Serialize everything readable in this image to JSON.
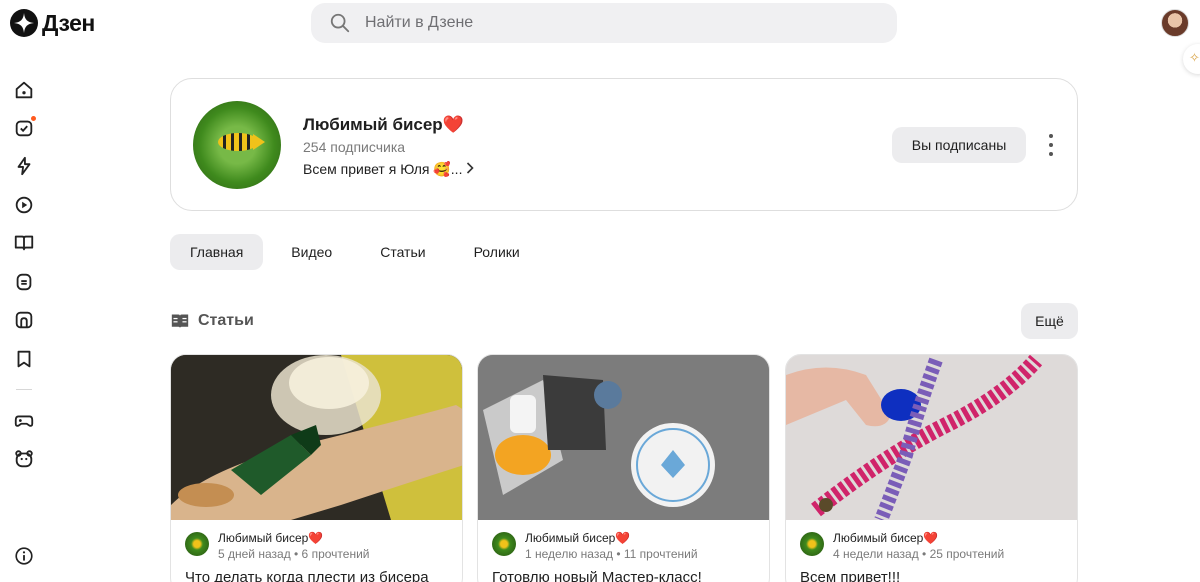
{
  "header": {
    "logo_text": "Дзен",
    "search_placeholder": "Найти в Дзене"
  },
  "nav": {
    "items": [
      "home-icon",
      "subscriptions-icon",
      "lightning-icon",
      "video-icon",
      "articles-icon",
      "chat-icon",
      "shorts-icon",
      "bookmark-icon",
      "gamepad-icon",
      "kids-icon",
      "info-icon"
    ]
  },
  "channel": {
    "name": "Любимый бисер",
    "heart": "❤️",
    "subscribers": "254 подписчика",
    "description": "Всем привет я Юля 🥰...",
    "subscribed_label": "Вы подписаны"
  },
  "tabs": [
    {
      "label": "Главная",
      "active": true
    },
    {
      "label": "Видео",
      "active": false
    },
    {
      "label": "Статьи",
      "active": false
    },
    {
      "label": "Ролики",
      "active": false
    }
  ],
  "section": {
    "title": "Статьи",
    "more_label": "Ещё"
  },
  "cards": [
    {
      "author": "Любимый бисер",
      "heart": "❤️",
      "meta": "5 дней назад • 6 прочтений",
      "title": "Что делать когда плести из бисера"
    },
    {
      "author": "Любимый бисер",
      "heart": "❤️",
      "meta": "1 неделю назад • 11 прочтений",
      "title": "Готовлю новый Мастер-класс!"
    },
    {
      "author": "Любимый бисер",
      "heart": "❤️",
      "meta": "4 недели назад • 25 прочтений",
      "title": "Всем привет!!!"
    }
  ],
  "colors": {
    "accent_dot": "#ff5a1f",
    "heart": "#e2333c",
    "button_bg": "#ececee"
  }
}
